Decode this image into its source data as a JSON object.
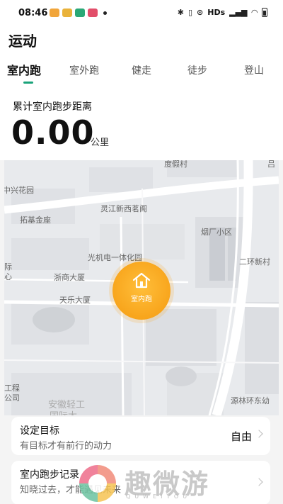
{
  "status_bar": {
    "time": "08:46",
    "app_icons": [
      "#f1a53a",
      "#e9b23a",
      "#2aa876",
      "#e24e6a"
    ],
    "network_label": "HDs",
    "signal_text": "⁴ᴳ"
  },
  "header": {
    "title": "运动",
    "tabs": [
      {
        "label": "室内跑",
        "active": true
      },
      {
        "label": "室外跑",
        "active": false
      },
      {
        "label": "健走",
        "active": false
      },
      {
        "label": "徒步",
        "active": false
      },
      {
        "label": "登山",
        "active": false
      }
    ],
    "accent_color": "#1aa37a"
  },
  "distance": {
    "label": "累计室内跑步距离",
    "value": "0.00",
    "unit": "公里"
  },
  "map": {
    "labels": [
      "度假村",
      "中兴花园",
      "灵江新西茗阁",
      "拓基金座",
      "烟厂小区",
      "光机电一体化园",
      "二环新村",
      "浙商大厦",
      "际",
      "心",
      "天乐大厦",
      "工程",
      "公司",
      "安徽轻工",
      "国际大",
      "源林环东幼",
      "吕"
    ]
  },
  "start_button": {
    "label": "室内跑",
    "icon": "house-icon",
    "color": "#f8a51c"
  },
  "goal_card": {
    "title": "设定目标",
    "subtitle": "有目标才有前行的动力",
    "value": "自由"
  },
  "records_card": {
    "title": "室内跑步记录",
    "subtitle": "知晓过去，才能遇见未来"
  },
  "watermark": {
    "text": "趣微游",
    "sub": "QUWEIYOU"
  }
}
